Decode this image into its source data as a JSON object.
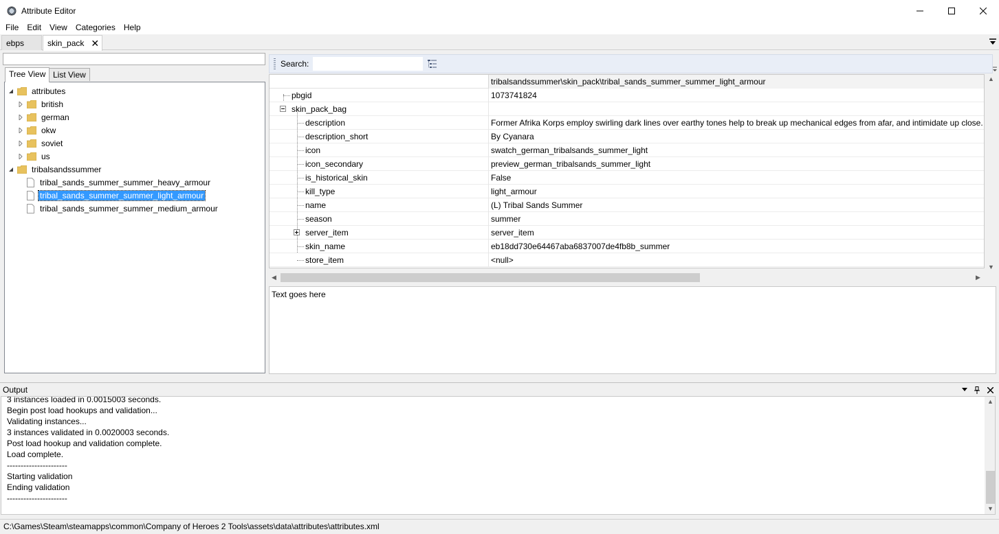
{
  "window": {
    "title": "Attribute Editor",
    "icon": "app-icon",
    "controls": [
      "minimize-icon",
      "maximize-icon",
      "close-icon"
    ]
  },
  "menu": [
    "File",
    "Edit",
    "View",
    "Categories",
    "Help"
  ],
  "doc_tabs": [
    {
      "label": "ebps",
      "active": false
    },
    {
      "label": "skin_pack",
      "active": true,
      "closable": true
    }
  ],
  "left": {
    "filter_value": "",
    "view_tabs": [
      {
        "label": "Tree View",
        "active": true
      },
      {
        "label": "List View",
        "active": false
      }
    ],
    "tree": {
      "root": "attributes",
      "children": [
        "british",
        "german",
        "okw",
        "soviet",
        "us"
      ],
      "root2": "tribalsandssummer",
      "files": [
        "tribal_sands_summer_summer_heavy_armour",
        "tribal_sands_summer_summer_light_armour",
        "tribal_sands_summer_summer_medium_armour"
      ],
      "selected_index": 1
    }
  },
  "right": {
    "search_label": "Search:",
    "search_value": "",
    "path_header": "tribalsandssummer\\skin_pack\\tribal_sands_summer_summer_light_armour",
    "rows": [
      {
        "name": "pbgid",
        "value": "1073741824"
      },
      {
        "name": "skin_pack_bag",
        "value": ""
      },
      {
        "name": "description",
        "value": "Former Afrika Korps employ swirling dark lines over earthy tones help to break up mechanical edges from afar, and intimidate up close."
      },
      {
        "name": "description_short",
        "value": "By Cyanara"
      },
      {
        "name": "icon",
        "value": "swatch_german_tribalsands_summer_light"
      },
      {
        "name": "icon_secondary",
        "value": "preview_german_tribalsands_summer_light"
      },
      {
        "name": "is_historical_skin",
        "value": "False"
      },
      {
        "name": "kill_type",
        "value": "light_armour"
      },
      {
        "name": "name",
        "value": "(L) Tribal Sands Summer"
      },
      {
        "name": "season",
        "value": "summer"
      },
      {
        "name": "server_item",
        "value": "server_item"
      },
      {
        "name": "skin_name",
        "value": "eb18dd730e64467aba6837007de4fb8b_summer"
      },
      {
        "name": "store_item",
        "value": "<null>"
      }
    ],
    "description_text": "Text goes here"
  },
  "output": {
    "title": "Output",
    "lines": [
      "3 instances loaded in 0.0015003 seconds.",
      "Begin post load hookups and validation...",
      "Validating instances...",
      "3 instances validated in 0.0020003 seconds.",
      "Post load hookup and validation complete.",
      "Load complete.",
      "----------------------",
      "Starting validation",
      "Ending validation",
      "----------------------"
    ]
  },
  "status": {
    "path": "C:\\Games\\Steam\\steamapps\\common\\Company of Heroes 2 Tools\\assets\\data\\attributes\\attributes.xml"
  },
  "colors": {
    "selection": "#3399ff",
    "search_bar": "#e9eef7",
    "folder": "#e8c25e"
  }
}
